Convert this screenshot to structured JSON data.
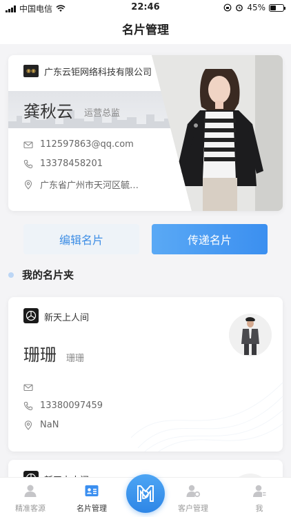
{
  "status_bar": {
    "carrier": "中国电信",
    "time": "22:46",
    "battery": "45%"
  },
  "nav": {
    "title": "名片管理"
  },
  "my_card": {
    "company": "广东云钜网络科技有限公司",
    "name": "龚秋云",
    "title": "运营总监",
    "email": "112597863@qq.com",
    "phone": "13378458201",
    "address": "广东省广州市天河区毓…"
  },
  "actions": {
    "edit_label": "编辑名片",
    "send_label": "传递名片"
  },
  "section": {
    "title": "我的名片夹"
  },
  "folder_cards": [
    {
      "company": "新天上人间",
      "name": "珊珊",
      "title": "珊珊",
      "email": "",
      "phone": "13380097459",
      "address": "NaN"
    },
    {
      "company": "新天上人间"
    }
  ],
  "tabbar": {
    "items": [
      {
        "label": "精准客源",
        "icon": "person-icon"
      },
      {
        "label": "名片管理",
        "icon": "card-icon"
      },
      {
        "label": "",
        "icon": "logo-icon"
      },
      {
        "label": "客户管理",
        "icon": "customer-manage-icon"
      },
      {
        "label": "我",
        "icon": "me-icon"
      }
    ]
  },
  "colors": {
    "accent": "#3b8ff0",
    "accent_light": "#eef3f8"
  }
}
